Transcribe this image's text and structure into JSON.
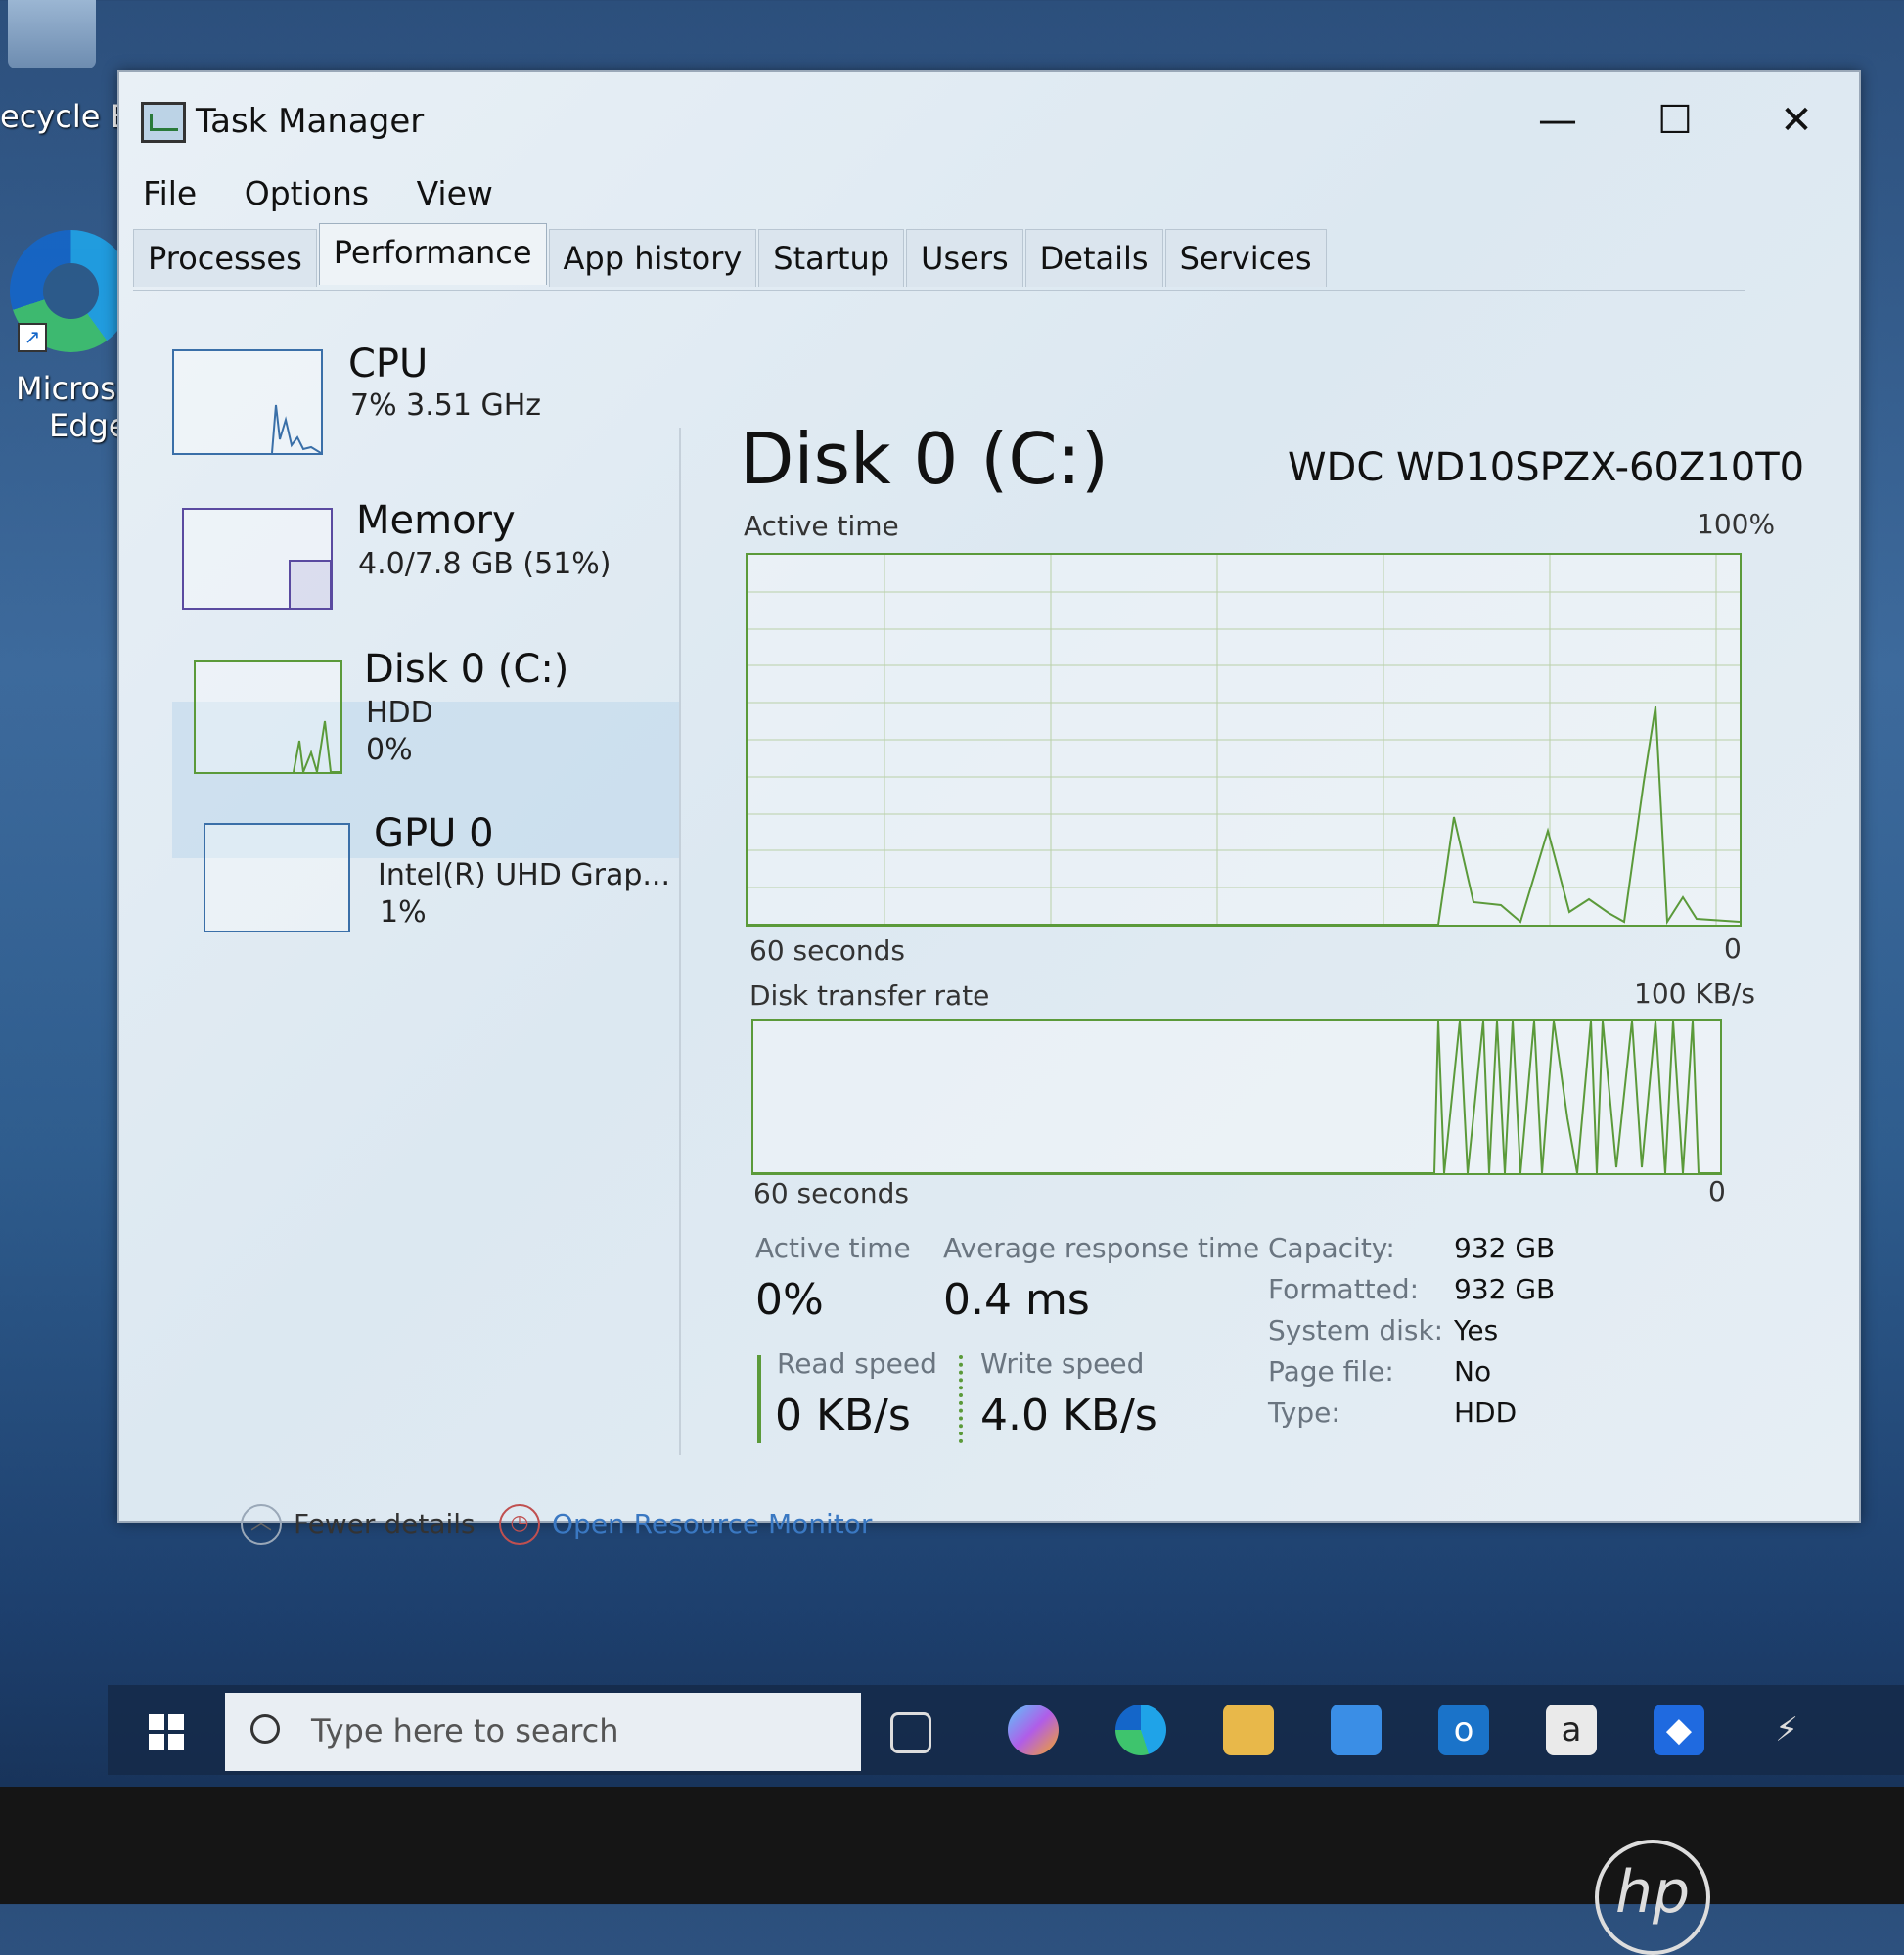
{
  "desktop": {
    "recycle_bin_label": "ecycle Bi",
    "edge_label_line1": "Microsof",
    "edge_label_line2": "Edge"
  },
  "window": {
    "title": "Task Manager",
    "controls": {
      "minimize": "—",
      "maximize": "☐",
      "close": "✕"
    }
  },
  "menu": [
    "File",
    "Options",
    "View"
  ],
  "tabs": [
    "Processes",
    "Performance",
    "App history",
    "Startup",
    "Users",
    "Details",
    "Services"
  ],
  "active_tab": "Performance",
  "perf_list": [
    {
      "name": "CPU",
      "sub1": "7% 3.51 GHz"
    },
    {
      "name": "Memory",
      "sub1": "4.0/7.8 GB (51%)"
    },
    {
      "name": "Disk 0 (C:)",
      "sub1": "HDD",
      "sub2": "0%"
    },
    {
      "name": "GPU 0",
      "sub1": "Intel(R) UHD Grap...",
      "sub2": "1%"
    }
  ],
  "detail": {
    "title": "Disk 0 (C:)",
    "model": "WDC WD10SPZX-60Z10T0",
    "active_time_graph": {
      "label": "Active time",
      "max": "100%",
      "time_span": "60 seconds",
      "min": "0"
    },
    "transfer_graph": {
      "label": "Disk transfer rate",
      "max": "100 KB/s",
      "time_span": "60 seconds",
      "min": "0"
    },
    "stats": {
      "active_time_label": "Active time",
      "active_time_value": "0%",
      "avg_response_label": "Average response time",
      "avg_response_value": "0.4 ms",
      "read_label": "Read speed",
      "read_value": "0 KB/s",
      "write_label": "Write speed",
      "write_value": "4.0 KB/s"
    },
    "properties": [
      {
        "label": "Capacity:",
        "value": "932 GB"
      },
      {
        "label": "Formatted:",
        "value": "932 GB"
      },
      {
        "label": "System disk:",
        "value": "Yes"
      },
      {
        "label": "Page file:",
        "value": "No"
      },
      {
        "label": "Type:",
        "value": "HDD"
      }
    ]
  },
  "footer": {
    "fewer_details": "Fewer details",
    "resource_monitor": "Open Resource Monitor"
  },
  "taskbar": {
    "search_placeholder": "Type here to search",
    "amazon_letter": "a"
  },
  "colors": {
    "graph_line": "#5b9a3a",
    "cpu_line": "#3a6fa8",
    "link": "#3a78c2"
  }
}
